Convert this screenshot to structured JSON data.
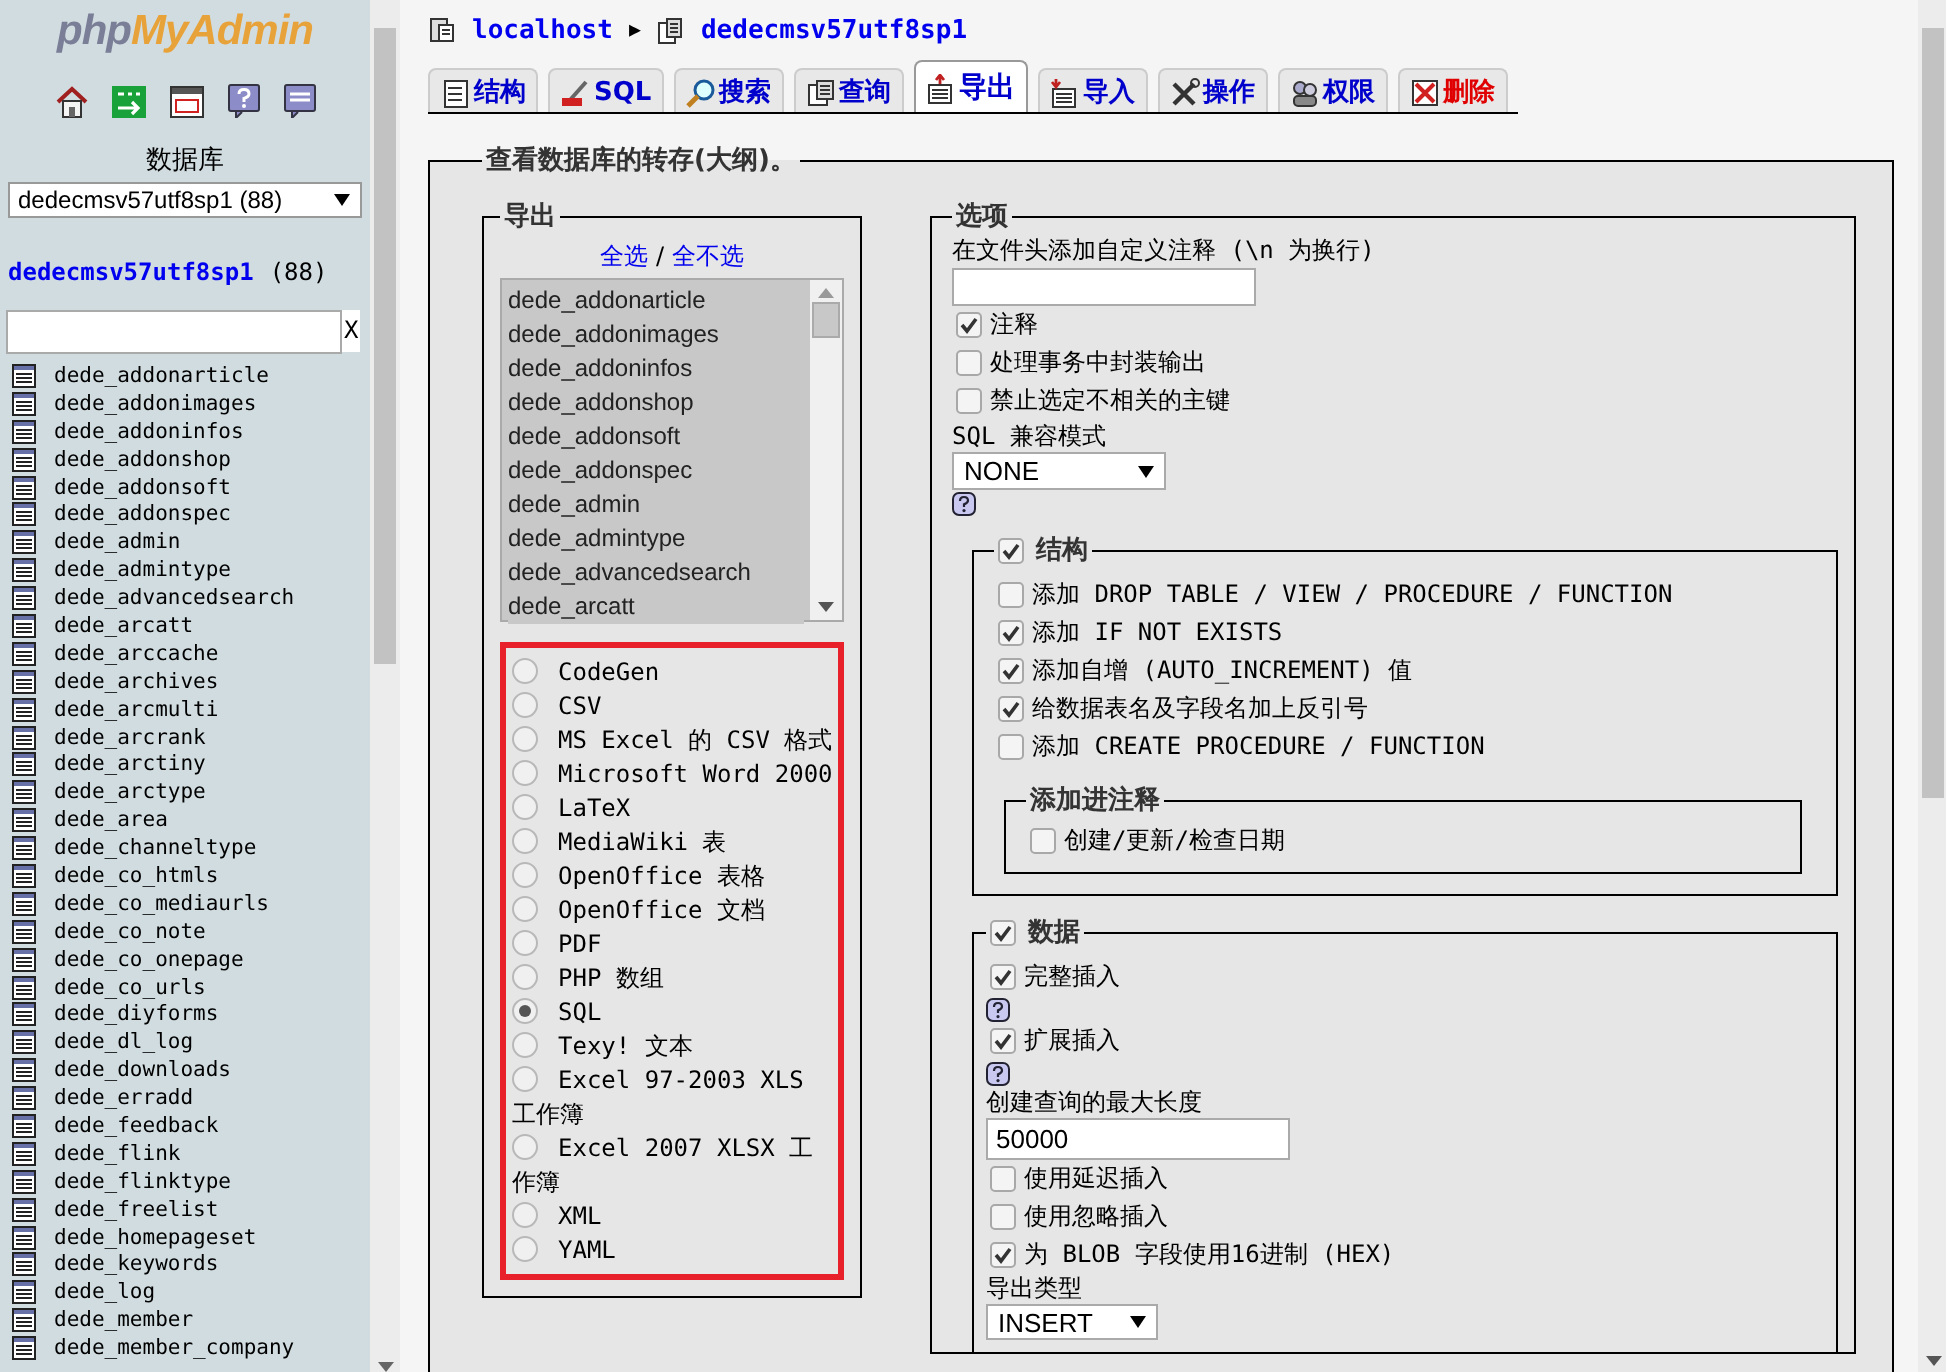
{
  "sidebar": {
    "logo": {
      "prefix": "php",
      "suffix": "MyAdmin"
    },
    "database_label": "数据库",
    "database_select": "dedecmsv57utf8sp1 (88)",
    "database_name": "dedecmsv57utf8sp1",
    "table_count": "(88)",
    "filter_clear": "X",
    "tables": [
      "dede_addonarticle",
      "dede_addonimages",
      "dede_addoninfos",
      "dede_addonshop",
      "dede_addonsoft",
      "dede_addonspec",
      "dede_admin",
      "dede_admintype",
      "dede_advancedsearch",
      "dede_arcatt",
      "dede_arccache",
      "dede_archives",
      "dede_arcmulti",
      "dede_arcrank",
      "dede_arctiny",
      "dede_arctype",
      "dede_area",
      "dede_channeltype",
      "dede_co_htmls",
      "dede_co_mediaurls",
      "dede_co_note",
      "dede_co_onepage",
      "dede_co_urls",
      "dede_diyforms",
      "dede_dl_log",
      "dede_downloads",
      "dede_erradd",
      "dede_feedback",
      "dede_flink",
      "dede_flinktype",
      "dede_freelist",
      "dede_homepageset",
      "dede_keywords",
      "dede_log",
      "dede_member",
      "dede_member_company"
    ]
  },
  "breadcrumb": {
    "server": "localhost",
    "separator": "▶",
    "database": "dedecmsv57utf8sp1"
  },
  "tabs": [
    {
      "label": "结构",
      "selected": false,
      "kind": "normal"
    },
    {
      "label": "SQL",
      "selected": false,
      "kind": "normal"
    },
    {
      "label": "搜索",
      "selected": false,
      "kind": "normal"
    },
    {
      "label": "查询",
      "selected": false,
      "kind": "normal"
    },
    {
      "label": "导出",
      "selected": true,
      "kind": "normal"
    },
    {
      "label": "导入",
      "selected": false,
      "kind": "normal"
    },
    {
      "label": "操作",
      "selected": false,
      "kind": "normal"
    },
    {
      "label": "权限",
      "selected": false,
      "kind": "normal"
    },
    {
      "label": "删除",
      "selected": false,
      "kind": "danger"
    }
  ],
  "dump": {
    "title": "查看数据库的转存(大纲)。",
    "export": {
      "title": "导出",
      "select_all": "全选",
      "separator": "/",
      "select_none": "全不选",
      "tables": [
        {
          "name": "dede_addonarticle",
          "selected": true
        },
        {
          "name": "dede_addonimages",
          "selected": true
        },
        {
          "name": "dede_addoninfos",
          "selected": true
        },
        {
          "name": "dede_addonshop",
          "selected": true
        },
        {
          "name": "dede_addonsoft",
          "selected": true
        },
        {
          "name": "dede_addonspec",
          "selected": true
        },
        {
          "name": "dede_admin",
          "selected": true
        },
        {
          "name": "dede_admintype",
          "selected": true
        },
        {
          "name": "dede_advancedsearch",
          "selected": true
        },
        {
          "name": "dede_arcatt",
          "selected": true
        }
      ],
      "formats": [
        {
          "label": "CodeGen",
          "selected": false
        },
        {
          "label": "CSV",
          "selected": false
        },
        {
          "label": "MS Excel 的 CSV 格式",
          "selected": false
        },
        {
          "label": "Microsoft Word 2000",
          "selected": false
        },
        {
          "label": "LaTeX",
          "selected": false
        },
        {
          "label": "MediaWiki 表",
          "selected": false
        },
        {
          "label": "OpenOffice 表格",
          "selected": false
        },
        {
          "label": "OpenOffice 文档",
          "selected": false
        },
        {
          "label": "PDF",
          "selected": false
        },
        {
          "label": "PHP 数组",
          "selected": false
        },
        {
          "label": "SQL",
          "selected": true
        },
        {
          "label": "Texy! 文本",
          "selected": false
        },
        {
          "label": "Excel 97-2003 XLS 工作簿",
          "selected": false
        },
        {
          "label": "Excel 2007 XLSX 工作簿",
          "selected": false
        },
        {
          "label": "XML",
          "selected": false
        },
        {
          "label": "YAML",
          "selected": false
        }
      ]
    },
    "options": {
      "title": "选项",
      "comment_label": "在文件头添加自定义注释 (\\n 为换行)",
      "checkboxes": [
        {
          "label": "注释",
          "checked": true
        },
        {
          "label": "处理事务中封装输出",
          "checked": false
        },
        {
          "label": "禁止选定不相关的主键",
          "checked": false
        }
      ],
      "compat_label": "SQL 兼容模式",
      "compat_value": "NONE",
      "structure": {
        "label": "结构",
        "checked": true,
        "options": [
          {
            "label": "添加 DROP TABLE / VIEW / PROCEDURE / FUNCTION",
            "checked": false
          },
          {
            "label": "添加 IF NOT EXISTS",
            "checked": true
          },
          {
            "label": "添加自增 (AUTO_INCREMENT) 值",
            "checked": true
          },
          {
            "label": "给数据表名及字段名加上反引号",
            "checked": true
          },
          {
            "label": "添加 CREATE PROCEDURE / FUNCTION",
            "checked": false
          }
        ],
        "comments": {
          "title": "添加进注释",
          "options": [
            {
              "label": "创建/更新/检查日期",
              "checked": false
            }
          ]
        }
      },
      "data": {
        "label": "数据",
        "checked": true,
        "items": [
          {
            "kind": "checkbox",
            "label": "完整插入",
            "checked": true
          },
          {
            "kind": "help"
          },
          {
            "kind": "checkbox",
            "label": "扩展插入",
            "checked": true
          },
          {
            "kind": "help"
          },
          {
            "kind": "text",
            "label": "创建查询的最大长度",
            "value": "50000"
          },
          {
            "kind": "checkbox",
            "label": "使用延迟插入",
            "checked": false
          },
          {
            "kind": "checkbox",
            "label": "使用忽略插入",
            "checked": false
          },
          {
            "kind": "checkbox",
            "label": "为 BLOB 字段使用16进制 (HEX)",
            "checked": true
          },
          {
            "kind": "select",
            "label": "导出类型",
            "value": "INSERT"
          }
        ]
      }
    }
  }
}
